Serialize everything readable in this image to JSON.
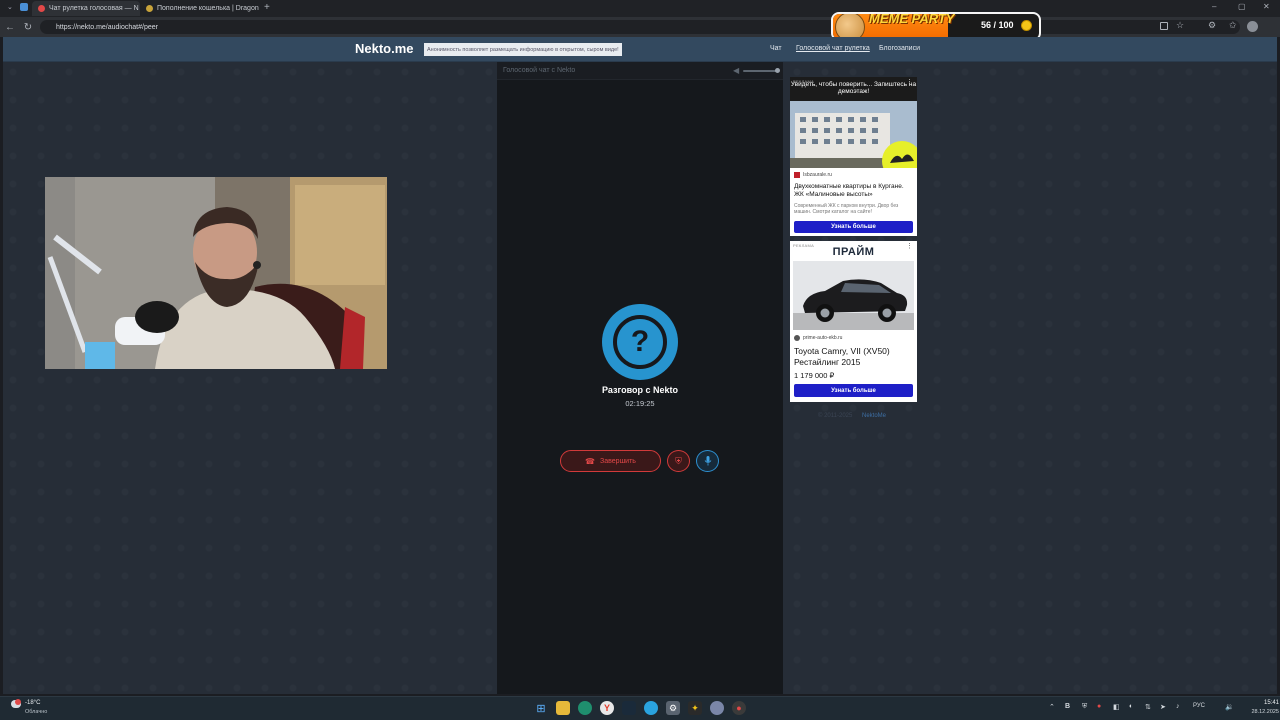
{
  "browser": {
    "tabs": [
      {
        "title": "Чат рулетка голосовая — N",
        "active": true
      },
      {
        "title": "Пополнение кошелька | Dragon",
        "active": false
      }
    ],
    "url": "https://nekto.me/audiochat#/peer"
  },
  "overlay": {
    "title": "MEME PARTY",
    "score": "56 / 100",
    "progress_fraction": 0.56
  },
  "site": {
    "logo": "Nekto.me",
    "anon_notice": "Анонимность позволяет размещать информацию в открытом, сыром виде!",
    "nav": [
      "Чат",
      "Голосовой чат рулетка",
      "Блогозаписи"
    ]
  },
  "chat": {
    "panel_title": "Голосовой чат с Nekto",
    "avatar_symbol": "?",
    "conversation_title": "Разговор с Nekto",
    "timer": "02:19:25",
    "end_label": "Завершить",
    "volume_level": 0.95
  },
  "ads": [
    {
      "label": "РЕКЛАМА",
      "banner": "Увидеть, чтобы поверить... Запиштесь на демоэтаж!",
      "domain": "Isbzaurale.ru",
      "title": "Двухкомнатные квартиры в Кургане. ЖК «Малиновые высоты»",
      "desc": "Современный ЖК с парком внутри. Двор без машин. Смотри каталог на сайте!",
      "button": "Узнать больше"
    },
    {
      "label": "РЕКЛАМА",
      "brand": "ПРАЙМ",
      "domain": "prime-auto-ekb.ru",
      "title": "Toyota Camry, VII (XV50) Рестайлинг 2015",
      "price": "1 179 000 ₽",
      "button": "Узнать больше"
    }
  ],
  "footer": {
    "copyright": "© 2011-2025",
    "link": "NektoMe"
  },
  "taskbar": {
    "temperature": "-18°C",
    "weather": "Облачно",
    "lang": "РУС",
    "time": "15:41",
    "date": "28.12.2025"
  },
  "colors": {
    "accent": "#2794cf",
    "danger": "#d23a3a",
    "header": "#33495f",
    "ad_button": "#1e1fc7"
  }
}
